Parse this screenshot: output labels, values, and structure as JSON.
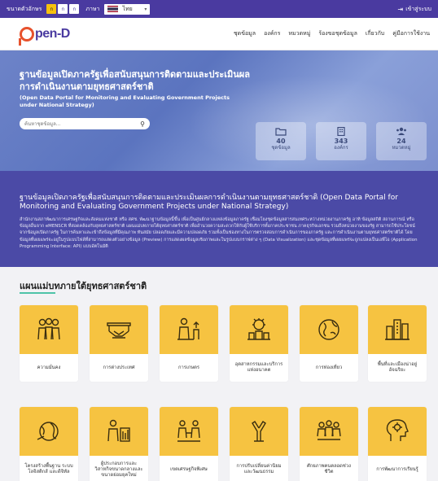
{
  "topbar": {
    "font_size_label": "ขนาดตัวอักษร",
    "font_buttons": [
      "ก",
      "ก",
      "ก"
    ],
    "language_label": "ภาษา",
    "language_value": "ไทย",
    "login_label": "เข้าสู่ระบบ"
  },
  "nav": {
    "logo_text": "pen-D",
    "menu": [
      "ชุดข้อมูล",
      "องค์กร",
      "หมวดหมู่",
      "ร้องขอชุดข้อมูล",
      "เกี่ยวกับ",
      "คู่มือการใช้งาน"
    ]
  },
  "hero": {
    "title": "ฐานข้อมูลเปิดภาครัฐเพื่อสนับสนุนการติดตามและประเมินผลการดำเนินงานตามยุทธศาสตร์ชาติ",
    "subtitle": "(Open Data Portal for Monitoring and Evaluating Government Projects under National Strategy)",
    "search_placeholder": "ค้นหาชุดข้อมูล...",
    "stats": [
      {
        "icon": "folder-icon",
        "value": "40",
        "label": "ชุดข้อมูล"
      },
      {
        "icon": "building-icon",
        "value": "343",
        "label": "องค์กร"
      },
      {
        "icon": "users-icon",
        "value": "24",
        "label": "หมวดหมู่"
      }
    ]
  },
  "about": {
    "title": "ฐานข้อมูลเปิดภาครัฐเพื่อสนับสนุนการติดตามและประเมินผลการดำเนินงานตามยุทธศาสตร์ชาติ (Open Data Portal for Monitoring and Evaluating Government Projects under National Strategy)",
    "text": "สำนักงานสภาพัฒนาการเศรษฐกิจและสังคมแห่งชาติ หรือ สศช. พัฒนาฐานข้อมูลนี้ขึ้น เพื่อเป็นศูนย์กลางแหล่งข้อมูลภาครัฐ เชื่อมโยงชุดข้อมูลสารสนเทศระหว่างหน่วยงานภาครัฐ อาทิ ข้อมูลสถิติ สถานการณ์ หรือข้อมูลอื่นจาก eMENSCR ที่สอดคล้องกับยุทธศาสตร์ชาติ แผนแม่บทภายใต้ยุทธศาสตร์ชาติ เพื่ออำนวยความสะดวกให้กับผู้ใช้บริการทั้งภาคประชาชน ภาคธุรกิจเอกชน รวมถึงหน่วยงานของรัฐ สามารถใช้ประโยชน์จากข้อมูลเปิดภาครัฐ ในการค้นหาและเข้าถึงข้อมูลที่มีคุณภาพ ทันสมัย ปลอดภัยและมีความปลอดภัย รวมทั้งเป็นช่องทางในการตรวจสอบการดำเนินการของภาครัฐ และการดำเนินงานตามยุทธศาสตร์ชาติได้ โดยข้อมูลที่เผยแพร่จะอยู่ในรูปแบบไฟล์ที่สามารถแสดงตัวอย่างข้อมูล (Preview) การแสดงผลข้อมูลเชิงภาพและในรูปแบบกราฟต่าง ๆ (Data Visualization) และชุดข้อมูลที่เผยแพร่จะถูกแปลงเป็นเอพีไอ (Application Programming Interface: API) แบบอัตโนมัติ"
  },
  "strategy": {
    "title": "แผนแม่บทภายใต้ยุทธศาสตร์ชาติ",
    "cards": [
      {
        "icon": "security-icon",
        "label": "ความมั่นคง"
      },
      {
        "icon": "handshake-icon",
        "label": "การต่างประเทศ"
      },
      {
        "icon": "agriculture-icon",
        "label": "การเกษตร"
      },
      {
        "icon": "industry-icon",
        "label": "อุตสาหกรรมและบริการแห่งอนาคต"
      },
      {
        "icon": "tourism-icon",
        "label": "การท่องเที่ยว"
      },
      {
        "icon": "city-icon",
        "label": "พื้นที่และเมืองน่าอยู่อัจฉริยะ"
      },
      {
        "icon": "infrastructure-icon",
        "label": "โครงสร้างพื้นฐาน ระบบโลจิสติกส์ และดิจิทัล"
      },
      {
        "icon": "sme-icon",
        "label": "ผู้ประกอบการและวิสาหกิจขนาดกลางและขนาดย่อมยุคใหม่"
      },
      {
        "icon": "special-economic-zone-icon",
        "label": "เขตเศรษฐกิจพิเศษ"
      },
      {
        "icon": "culture-icon",
        "label": "การปรับเปลี่ยนค่านิยมและวัฒนธรรม"
      },
      {
        "icon": "life-potential-icon",
        "label": "ศักยภาพคนตลอดช่วงชีวิต"
      },
      {
        "icon": "learning-icon",
        "label": "การพัฒนาการเรียนรู้"
      }
    ]
  }
}
